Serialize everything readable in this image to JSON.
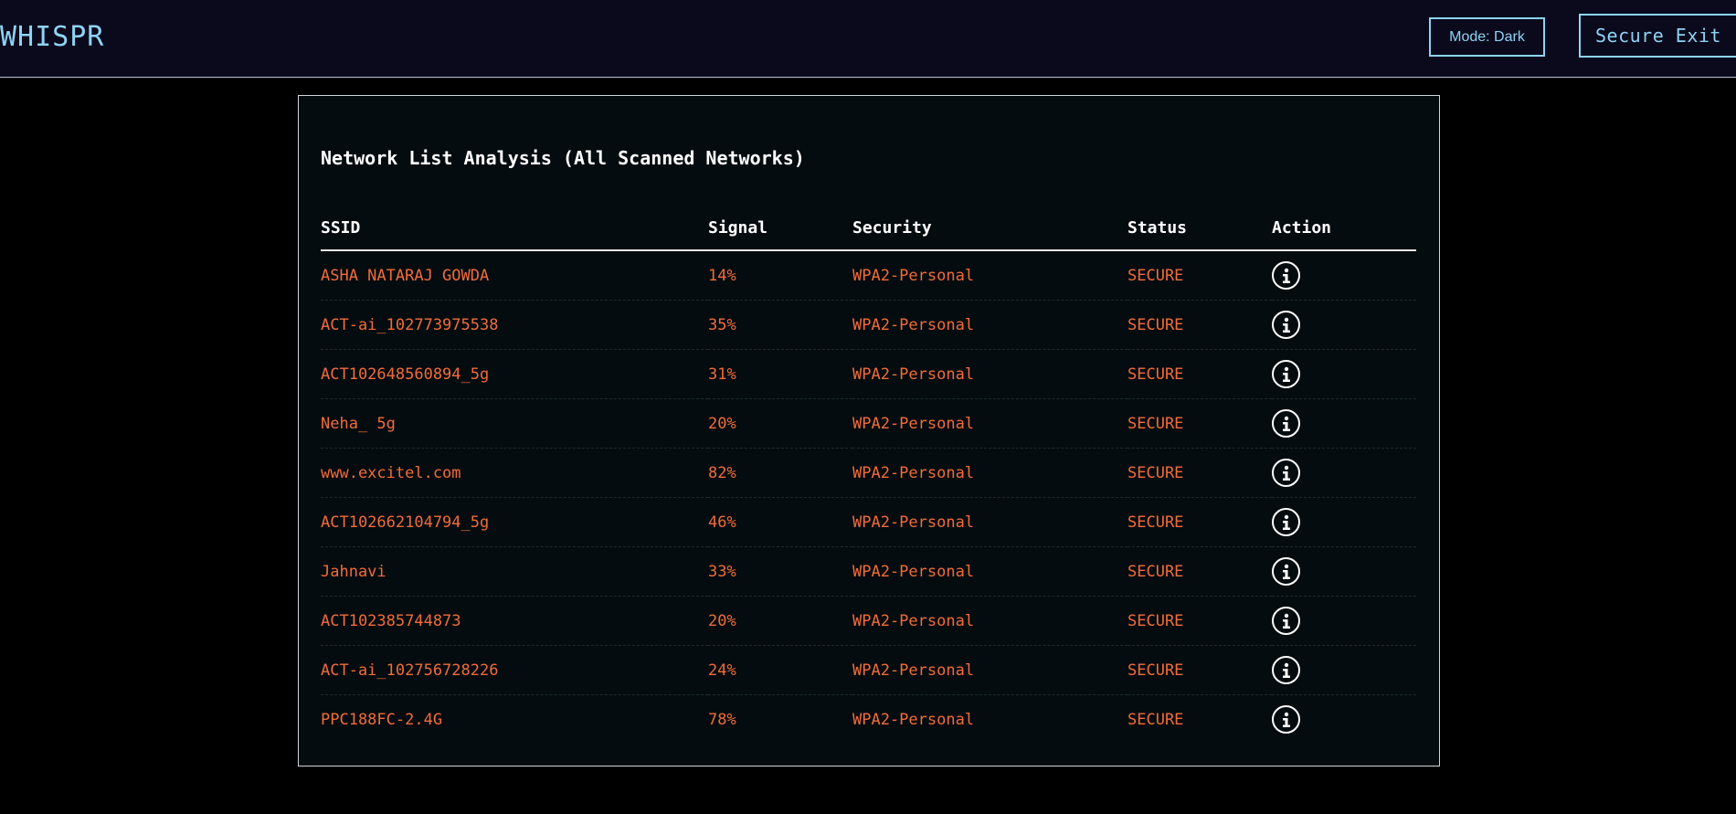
{
  "header": {
    "brand": "WHISPR",
    "mode_label": "Mode: Dark",
    "exit_label": "Secure Exit"
  },
  "panel": {
    "title": "Network List Analysis (All Scanned Networks)",
    "columns": {
      "ssid": "SSID",
      "signal": "Signal",
      "security": "Security",
      "status": "Status",
      "action": "Action"
    },
    "rows": [
      {
        "ssid": "ASHA NATARAJ GOWDA",
        "signal": "14%",
        "security": "WPA2-Personal",
        "status": "SECURE",
        "action_icon": "info-icon"
      },
      {
        "ssid": "ACT-ai_102773975538",
        "signal": "35%",
        "security": "WPA2-Personal",
        "status": "SECURE",
        "action_icon": "info-icon"
      },
      {
        "ssid": "ACT102648560894_5g",
        "signal": "31%",
        "security": "WPA2-Personal",
        "status": "SECURE",
        "action_icon": "info-icon"
      },
      {
        "ssid": "Neha_ 5g",
        "signal": "20%",
        "security": "WPA2-Personal",
        "status": "SECURE",
        "action_icon": "info-icon"
      },
      {
        "ssid": "www.excitel.com",
        "signal": "82%",
        "security": "WPA2-Personal",
        "status": "SECURE",
        "action_icon": "info-icon"
      },
      {
        "ssid": "ACT102662104794_5g",
        "signal": "46%",
        "security": "WPA2-Personal",
        "status": "SECURE",
        "action_icon": "info-icon"
      },
      {
        "ssid": "Jahnavi",
        "signal": "33%",
        "security": "WPA2-Personal",
        "status": "SECURE",
        "action_icon": "info-icon"
      },
      {
        "ssid": "ACT102385744873",
        "signal": "20%",
        "security": "WPA2-Personal",
        "status": "SECURE",
        "action_icon": "info-icon"
      },
      {
        "ssid": "ACT-ai_102756728226",
        "signal": "24%",
        "security": "WPA2-Personal",
        "status": "SECURE",
        "action_icon": "info-icon"
      },
      {
        "ssid": "PPC188FC-2.4G",
        "signal": "78%",
        "security": "WPA2-Personal",
        "status": "SECURE",
        "action_icon": "info-icon"
      }
    ]
  },
  "colors": {
    "accent": "#8fd3f4",
    "row_text": "#f26b3a",
    "topbar_bg": "#0a0a1c",
    "panel_bg": "#040c0f",
    "page_bg": "#000000"
  }
}
